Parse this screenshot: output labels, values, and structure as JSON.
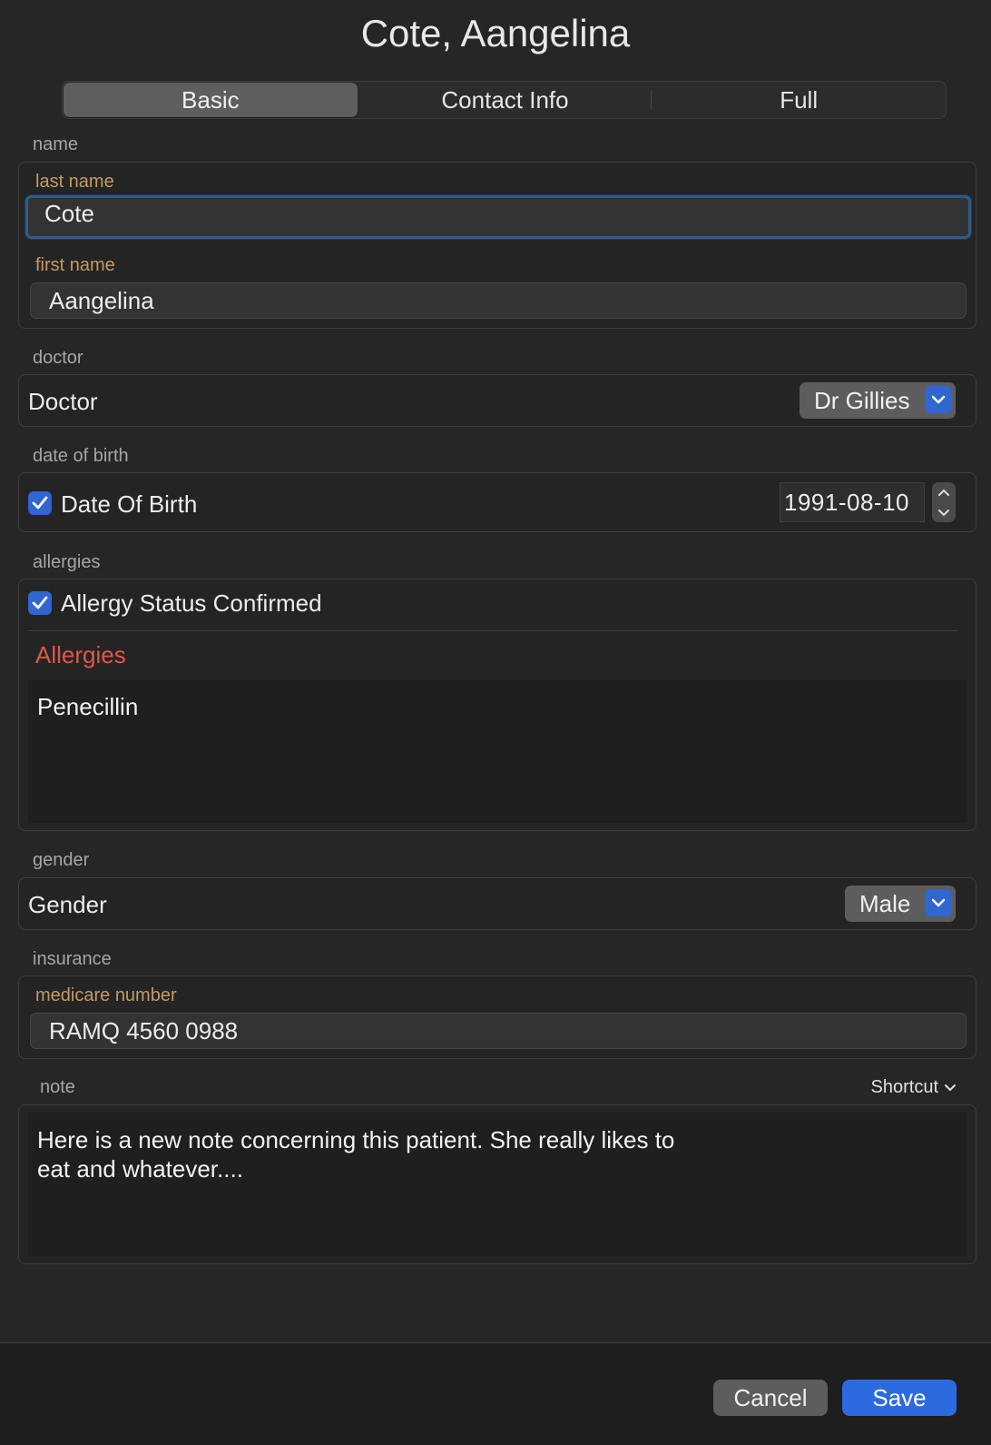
{
  "window": {
    "title": "Cote, Aangelina"
  },
  "tabs": [
    {
      "label": "Basic",
      "active": true
    },
    {
      "label": "Contact Info",
      "active": false
    },
    {
      "label": "Full",
      "active": false
    }
  ],
  "name_section": {
    "label": "name",
    "last_name_label": "last name",
    "last_name_value": "Cote",
    "first_name_label": "first name",
    "first_name_value": "Aangelina"
  },
  "doctor_section": {
    "label": "doctor",
    "row_label": "Doctor",
    "selected": "Dr Gillies"
  },
  "dob_section": {
    "label": "date of birth",
    "checkbox_label": "Date Of Birth",
    "checked": true,
    "value": "1991-08-10"
  },
  "allergies_section": {
    "label": "allergies",
    "checkbox_label": "Allergy Status Confirmed",
    "checked": true,
    "list_label": "Allergies",
    "text": "Penecillin"
  },
  "gender_section": {
    "label": "gender",
    "row_label": "Gender",
    "selected": "Male"
  },
  "insurance_section": {
    "label": "insurance",
    "medicare_label": "medicare number",
    "medicare_value": "RAMQ 4560 0988"
  },
  "note_section": {
    "label": "note",
    "shortcut_label": "Shortcut",
    "text": "Here is a new note concerning this patient. She really likes to\neat and whatever...."
  },
  "footer": {
    "cancel_label": "Cancel",
    "save_label": "Save"
  },
  "colors": {
    "accent": "#2d6ae0",
    "field_label": "#c39a66",
    "allergies_label": "#e0574a",
    "focus_ring": "#2f5b86"
  }
}
